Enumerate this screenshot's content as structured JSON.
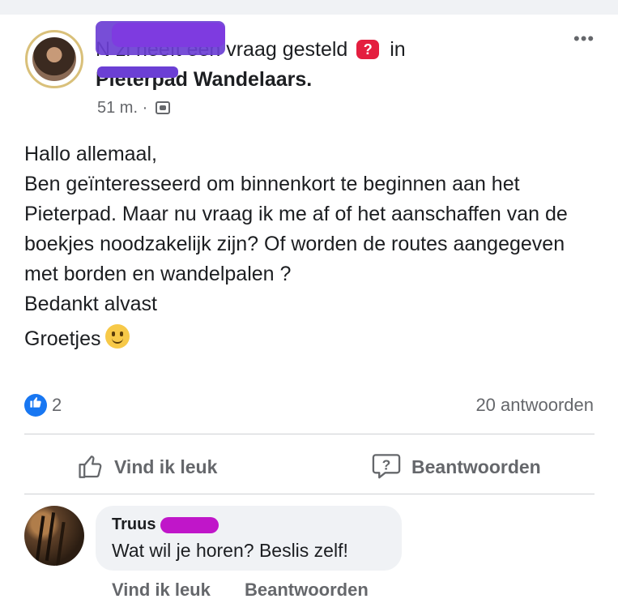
{
  "post": {
    "author_visible": "N                zi",
    "action_text": "heeft een vraag gesteld",
    "question_badge": "?",
    "in_text": "in",
    "group": "Pieterpad Wandelaars.",
    "time": "51 m. ·",
    "audience_icon": "group-icon",
    "more": "•••",
    "body": {
      "line1": "Hallo allemaal,",
      "line2": "Ben geïnteresseerd om binnenkort te beginnen aan het Pieterpad. Maar nu vraag ik me af of het aanschaffen van de boekjes noodzakelijk zijn? Of worden de routes aangegeven met borden en wandelpalen ?",
      "line3": "Bedankt alvast",
      "line4": "Groetjes"
    },
    "like_count": "2",
    "answers": "20 antwoorden"
  },
  "actions": {
    "like_label": "Vind ik leuk",
    "answer_label": "Beantwoorden"
  },
  "comment": {
    "name": "Truus",
    "text": "Wat wil je horen? Beslis zelf!",
    "like_label": "Vind ik leuk",
    "reply_label": "Beantwoorden"
  },
  "colors": {
    "facebook_blue": "#1877f2",
    "question_red": "#e41e3f",
    "secondary_text": "#65676b",
    "redaction_purple": "#6b3fd4",
    "redaction_magenta": "#c016c9"
  }
}
